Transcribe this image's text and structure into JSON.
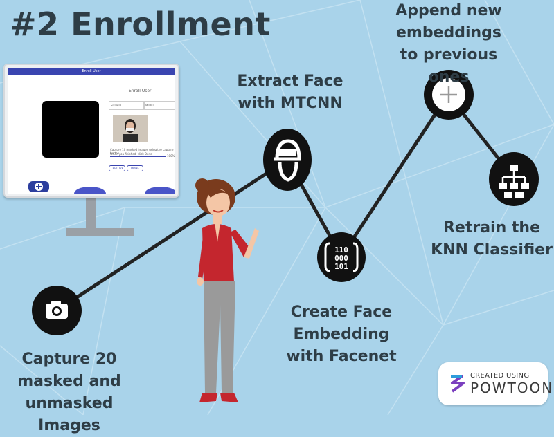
{
  "title": "#2 Enrollment",
  "steps": [
    {
      "label": "Capture 20 masked and unmasked Images",
      "icon": "camera-icon"
    },
    {
      "label": "Extract Face with MTCNN",
      "icon": "face-icon"
    },
    {
      "label": "Create Face Embedding with Facenet",
      "icon": "binary-data-icon"
    },
    {
      "label": "Append new embeddings to previous ones",
      "icon": "plus-icon"
    },
    {
      "label": "Retrain the KNN Classifier",
      "icon": "hierarchy-icon"
    }
  ],
  "monitor_screen": {
    "header": "Enroll User",
    "heading": "Enroll User",
    "field1": "SUDHIR",
    "field2": "MUMT",
    "instruction1": "Capture 10 masked images using the capture button",
    "instruction2": "When you finished, click Done",
    "progress": "100%",
    "button1": "CAPTURE",
    "button2": "DONE"
  },
  "badge": {
    "small": "CREATED USING",
    "big": "POWTOON"
  },
  "colors": {
    "background": "#a9d3ea",
    "node": "#111111",
    "text": "#2e3d46",
    "accent": "#3a45b0"
  }
}
